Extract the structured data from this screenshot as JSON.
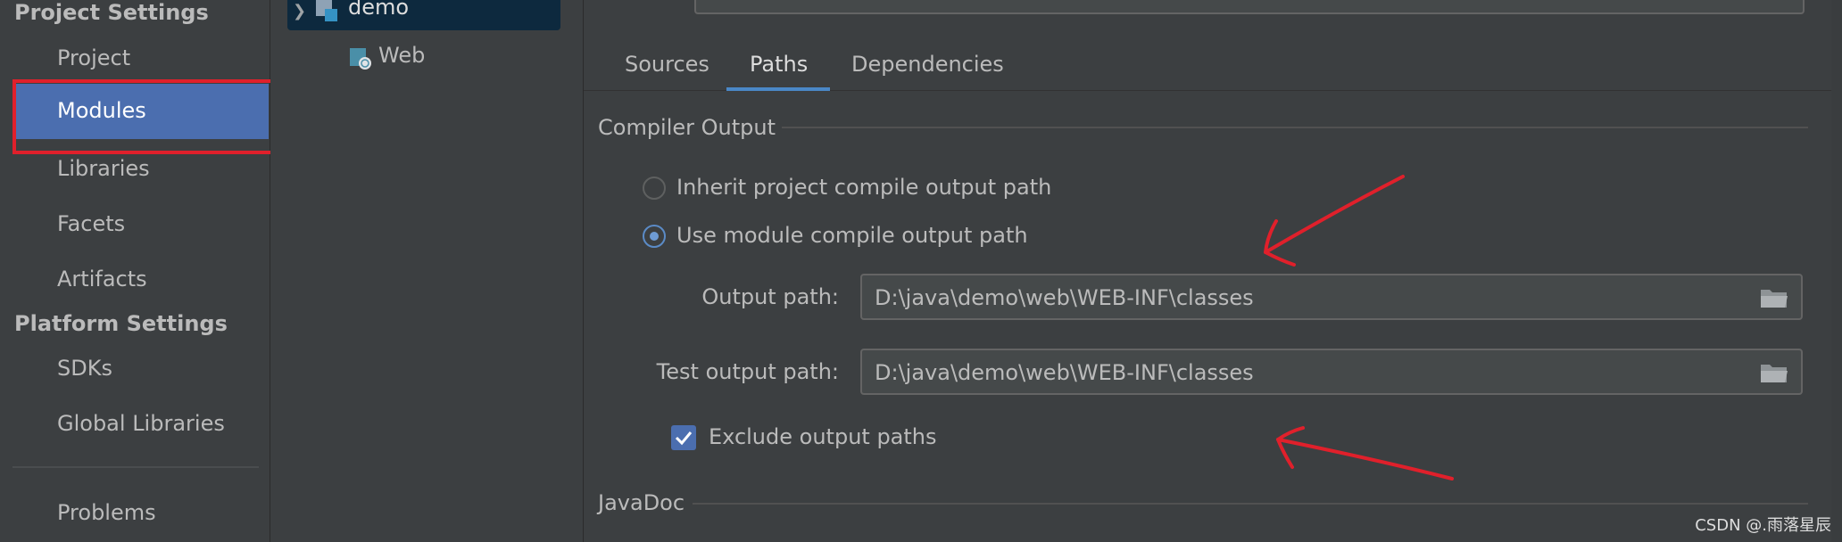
{
  "sidebar": {
    "project_settings_title": "Project Settings",
    "items": [
      {
        "label": "Project"
      },
      {
        "label": "Modules"
      },
      {
        "label": "Libraries"
      },
      {
        "label": "Facets"
      },
      {
        "label": "Artifacts"
      }
    ],
    "platform_settings_title": "Platform Settings",
    "platform_items": [
      {
        "label": "SDKs"
      },
      {
        "label": "Global Libraries"
      }
    ],
    "problems_label": "Problems"
  },
  "tree": {
    "root": {
      "label": "demo",
      "icon": "module-icon"
    },
    "children": [
      {
        "label": "Web",
        "icon": "web-facet-icon"
      }
    ]
  },
  "main": {
    "tabs": [
      {
        "label": "Sources"
      },
      {
        "label": "Paths",
        "selected": true
      },
      {
        "label": "Dependencies"
      }
    ],
    "compiler_output": {
      "title": "Compiler Output",
      "inherit_label": "Inherit project compile output path",
      "use_module_label": "Use module compile output path",
      "selected_option": "use_module",
      "output_path_label": "Output path:",
      "output_path_value": "D:\\java\\demo\\web\\WEB-INF\\classes",
      "test_output_path_label": "Test output path:",
      "test_output_path_value": "D:\\java\\demo\\web\\WEB-INF\\classes",
      "exclude_label": "Exclude output paths",
      "exclude_checked": true
    },
    "javadoc_title": "JavaDoc"
  },
  "watermark": "CSDN @.雨落星辰",
  "colors": {
    "background": "#3c3f41",
    "selection": "#4b6eaf",
    "annotation_red": "#e0202b",
    "tab_underline": "#4a88c7"
  }
}
